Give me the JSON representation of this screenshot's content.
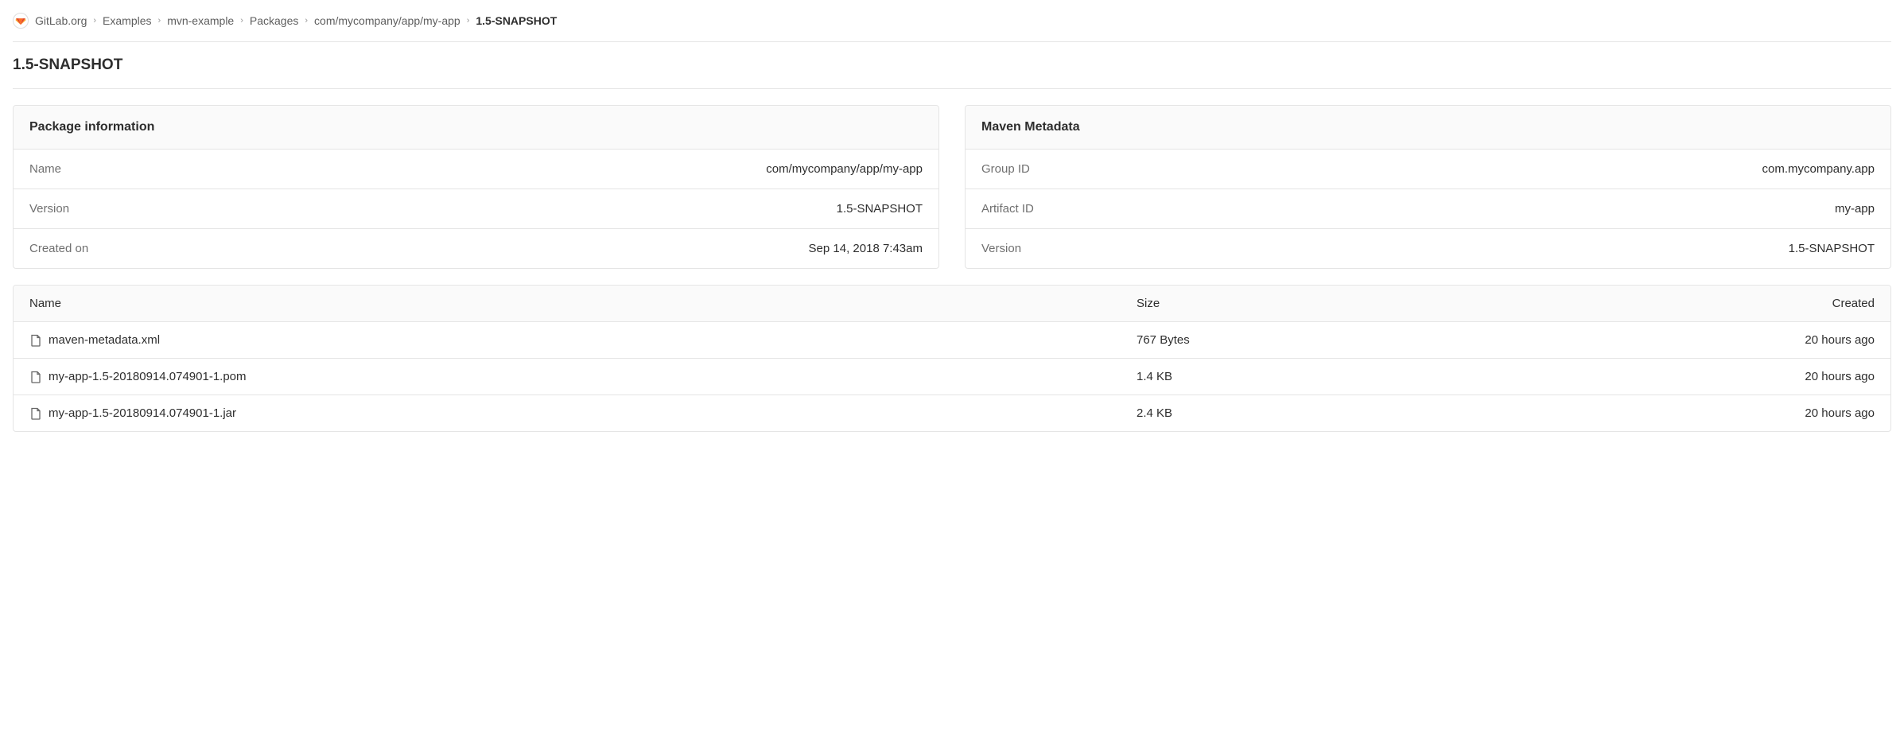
{
  "breadcrumb": {
    "items": [
      {
        "label": "GitLab.org"
      },
      {
        "label": "Examples"
      },
      {
        "label": "mvn-example"
      },
      {
        "label": "Packages"
      },
      {
        "label": "com/mycompany/app/my-app"
      }
    ],
    "current": "1.5-SNAPSHOT"
  },
  "page_title": "1.5-SNAPSHOT",
  "package_info": {
    "header": "Package information",
    "rows": [
      {
        "label": "Name",
        "value": "com/mycompany/app/my-app"
      },
      {
        "label": "Version",
        "value": "1.5-SNAPSHOT"
      },
      {
        "label": "Created on",
        "value": "Sep 14, 2018 7:43am"
      }
    ]
  },
  "maven_metadata": {
    "header": "Maven Metadata",
    "rows": [
      {
        "label": "Group ID",
        "value": "com.mycompany.app"
      },
      {
        "label": "Artifact ID",
        "value": "my-app"
      },
      {
        "label": "Version",
        "value": "1.5-SNAPSHOT"
      }
    ]
  },
  "files_table": {
    "columns": {
      "name": "Name",
      "size": "Size",
      "created": "Created"
    },
    "rows": [
      {
        "name": "maven-metadata.xml",
        "size": "767 Bytes",
        "created": "20 hours ago"
      },
      {
        "name": "my-app-1.5-20180914.074901-1.pom",
        "size": "1.4 KB",
        "created": "20 hours ago"
      },
      {
        "name": "my-app-1.5-20180914.074901-1.jar",
        "size": "2.4 KB",
        "created": "20 hours ago"
      }
    ]
  }
}
